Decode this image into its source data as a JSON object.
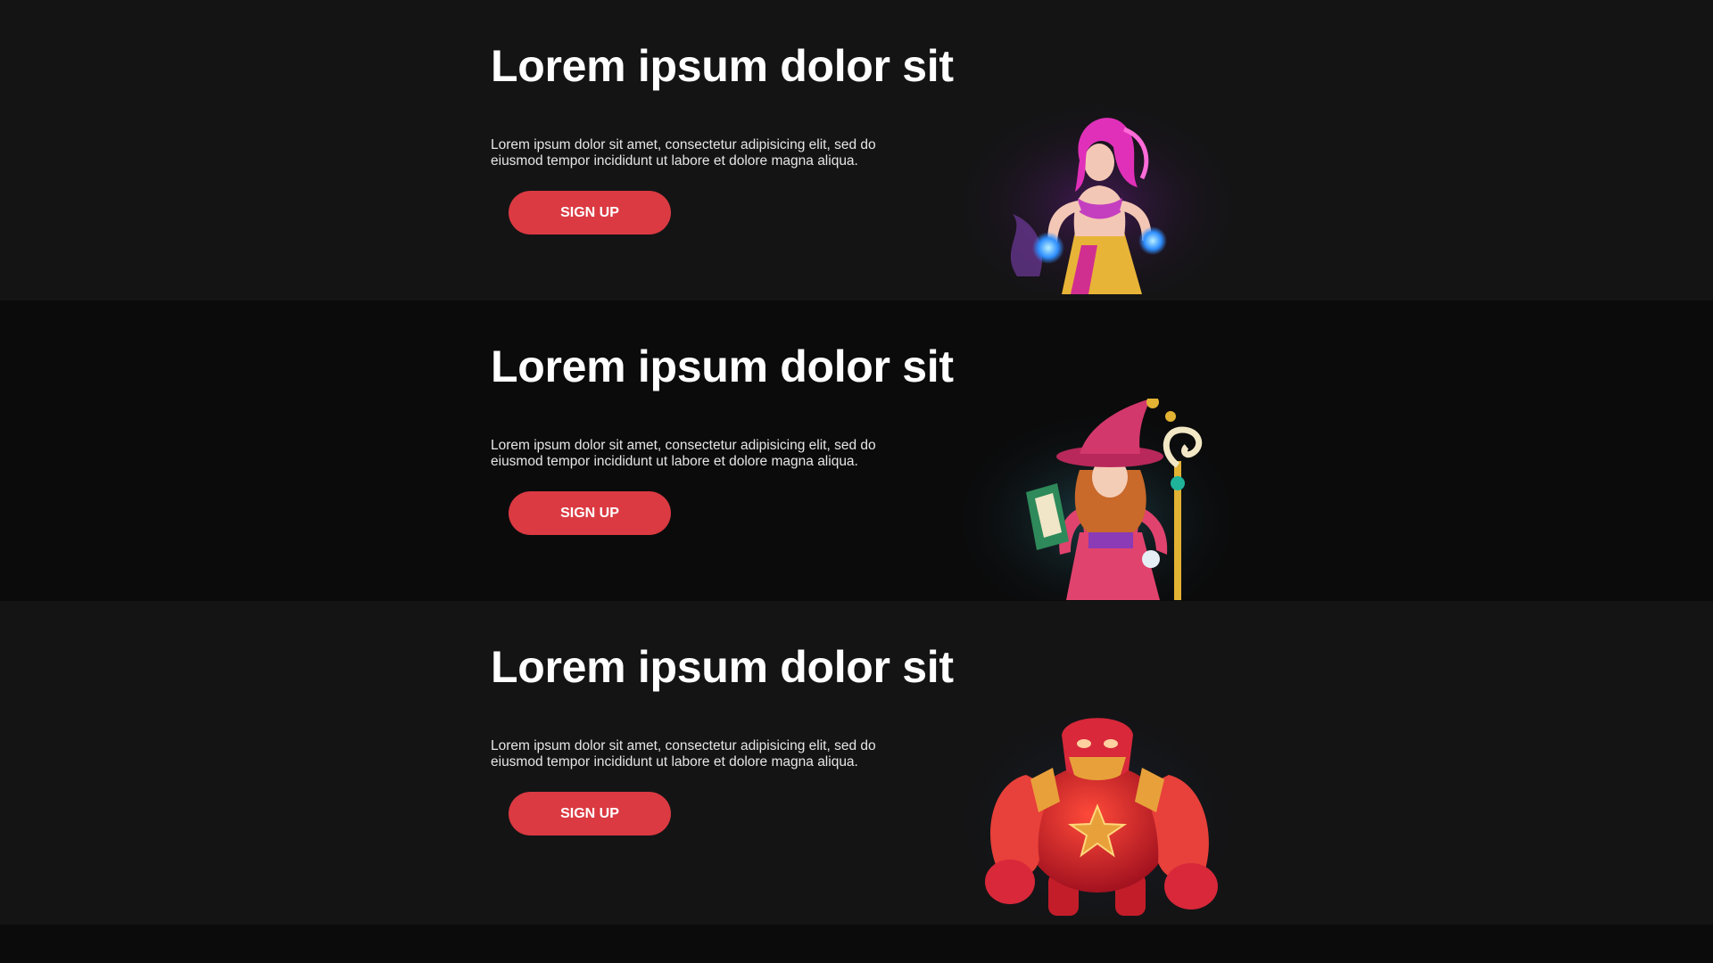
{
  "sections": [
    {
      "title": "Lorem ipsum dolor sit",
      "description": "Lorem ipsum dolor sit amet, consectetur adipisicing elit, sed do eiusmod tempor incididunt ut labore et dolore magna aliqua.",
      "button_label": "SIGN UP",
      "illustration": "sorceress-illustration"
    },
    {
      "title": "Lorem ipsum dolor sit",
      "description": "Lorem ipsum dolor sit amet, consectetur adipisicing elit, sed do eiusmod tempor incididunt ut labore et dolore magna aliqua.",
      "button_label": "SIGN UP",
      "illustration": "witch-illustration"
    },
    {
      "title": "Lorem ipsum dolor sit",
      "description": "Lorem ipsum dolor sit amet, consectetur adipisicing elit, sed do eiusmod tempor incididunt ut labore et dolore magna aliqua.",
      "button_label": "SIGN UP",
      "illustration": "golem-illustration"
    }
  ],
  "colors": {
    "background_dark": "#0b0b0c",
    "background_section": "#141415",
    "button": "#db3a42",
    "title": "#ffffff",
    "text": "#e6e6e6"
  }
}
